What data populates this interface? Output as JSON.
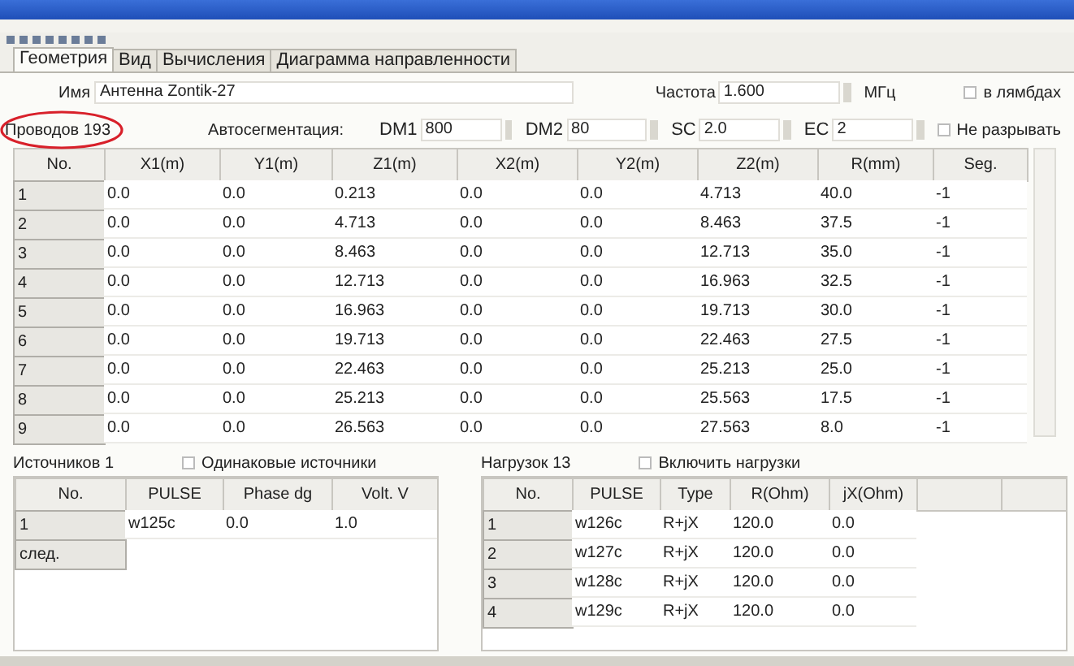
{
  "tabs": [
    {
      "label": "Геометрия",
      "selected": true
    },
    {
      "label": "Вид",
      "selected": false
    },
    {
      "label": "Вычисления",
      "selected": false
    },
    {
      "label": "Диаграмма направленности",
      "selected": false
    }
  ],
  "name": {
    "label": "Имя",
    "value": "Антенна Zontik-27"
  },
  "frequency": {
    "label": "Частота",
    "value": "1.600",
    "unit": "МГц"
  },
  "in_lambdas": {
    "label": "в лямбдах",
    "checked": false
  },
  "wires": {
    "label": "Проводов 193",
    "circled": true
  },
  "autoseg": {
    "label": "Автосегментация:",
    "fields": [
      {
        "label": "DM1",
        "value": "800"
      },
      {
        "label": "DM2",
        "value": "80"
      },
      {
        "label": "SC",
        "value": "2.0"
      },
      {
        "label": "EC",
        "value": "2"
      }
    ]
  },
  "no_break": {
    "label": "Не разрывать",
    "checked": false
  },
  "wire_table": {
    "columns": [
      "No.",
      "X1(m)",
      "Y1(m)",
      "Z1(m)",
      "X2(m)",
      "Y2(m)",
      "Z2(m)",
      "R(mm)",
      "Seg."
    ],
    "rows": [
      [
        "1",
        "0.0",
        "0.0",
        "0.213",
        "0.0",
        "0.0",
        "4.713",
        "40.0",
        "-1"
      ],
      [
        "2",
        "0.0",
        "0.0",
        "4.713",
        "0.0",
        "0.0",
        "8.463",
        "37.5",
        "-1"
      ],
      [
        "3",
        "0.0",
        "0.0",
        "8.463",
        "0.0",
        "0.0",
        "12.713",
        "35.0",
        "-1"
      ],
      [
        "4",
        "0.0",
        "0.0",
        "12.713",
        "0.0",
        "0.0",
        "16.963",
        "32.5",
        "-1"
      ],
      [
        "5",
        "0.0",
        "0.0",
        "16.963",
        "0.0",
        "0.0",
        "19.713",
        "30.0",
        "-1"
      ],
      [
        "6",
        "0.0",
        "0.0",
        "19.713",
        "0.0",
        "0.0",
        "22.463",
        "27.5",
        "-1"
      ],
      [
        "7",
        "0.0",
        "0.0",
        "22.463",
        "0.0",
        "0.0",
        "25.213",
        "25.0",
        "-1"
      ],
      [
        "8",
        "0.0",
        "0.0",
        "25.213",
        "0.0",
        "0.0",
        "25.563",
        "17.5",
        "-1"
      ],
      [
        "9",
        "0.0",
        "0.0",
        "26.563",
        "0.0",
        "0.0",
        "27.563",
        "8.0",
        "-1"
      ]
    ]
  },
  "sources": {
    "label": "Источников 1",
    "same": {
      "label": "Одинаковые источники",
      "checked": false
    },
    "columns": [
      "No.",
      "PULSE",
      "Phase dg",
      "Volt. V"
    ],
    "rows": [
      [
        "1",
        "w125c",
        "0.0",
        "1.0"
      ],
      [
        "след."
      ]
    ]
  },
  "loads": {
    "label": "Нагрузок 13",
    "enable": {
      "label": "Включить нагрузки",
      "checked": false
    },
    "columns": [
      "No.",
      "PULSE",
      "Type",
      "R(Ohm)",
      "jX(Ohm)"
    ],
    "rows": [
      [
        "1",
        "w126c",
        "R+jX",
        "120.0",
        "0.0"
      ],
      [
        "2",
        "w127c",
        "R+jX",
        "120.0",
        "0.0"
      ],
      [
        "3",
        "w128c",
        "R+jX",
        "120.0",
        "0.0"
      ],
      [
        "4",
        "w129c",
        "R+jX",
        "120.0",
        "0.0"
      ]
    ]
  }
}
